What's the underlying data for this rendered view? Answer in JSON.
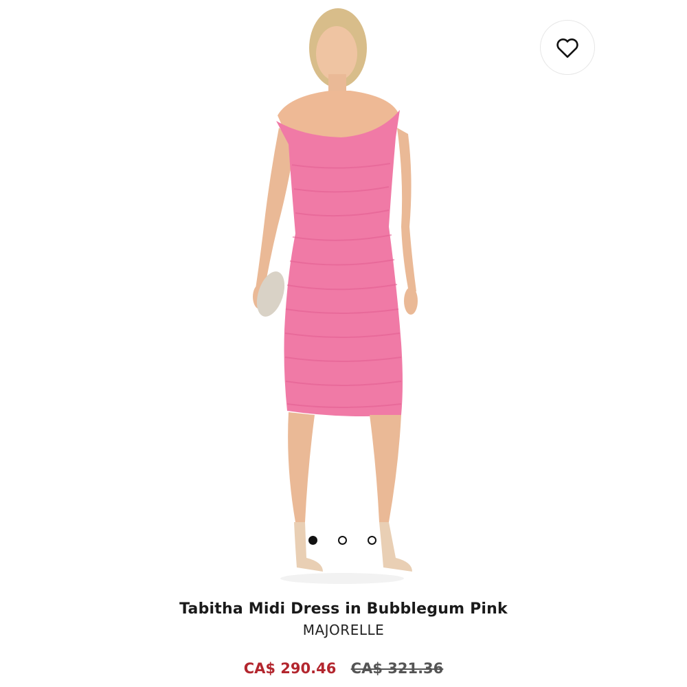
{
  "product": {
    "title": "Tabitha Midi Dress in Bubblegum Pink",
    "brand": "MAJORELLE",
    "sale_price": "CA$ 290.46",
    "original_price": "CA$ 321.36",
    "image": {
      "dress_color": "#f07aa6",
      "skin_color": "#f1c7a6",
      "hair_color": "#d9c08e"
    }
  },
  "wishlist": {
    "icon": "heart-icon"
  },
  "carousel": {
    "total": 3,
    "active_index": 0
  },
  "colors": {
    "sale_price": "#b3262e",
    "original_price": "#555555"
  }
}
